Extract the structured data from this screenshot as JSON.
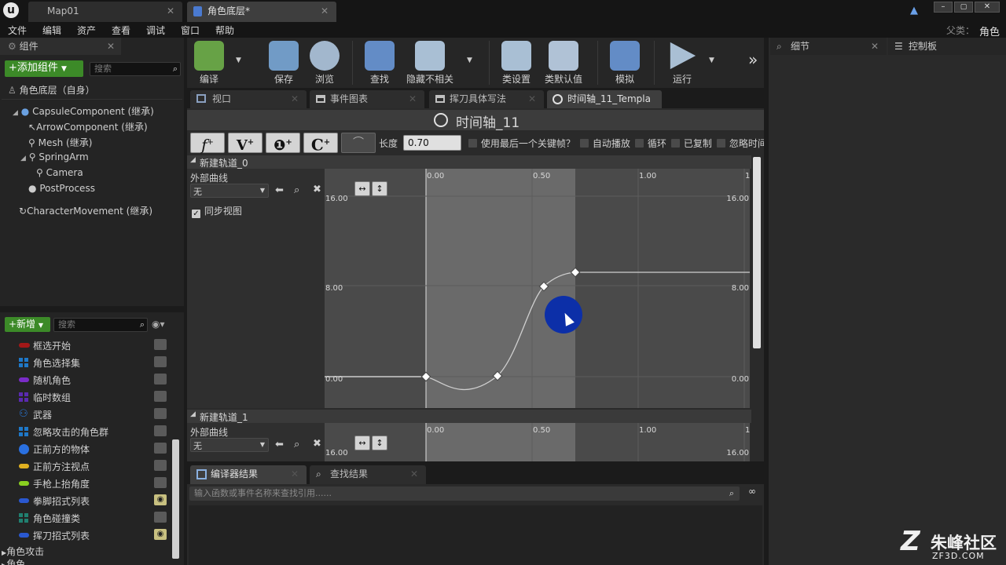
{
  "titlebar": {
    "tabs": [
      {
        "label": "Map01"
      },
      {
        "label": "角色底层*"
      }
    ],
    "parent_label": "父类：",
    "parent_value": "角色"
  },
  "menu": [
    "文件",
    "编辑",
    "资产",
    "查看",
    "调试",
    "窗口",
    "帮助"
  ],
  "components_panel": {
    "title": "组件",
    "add_button": "+添加组件",
    "search_placeholder": "搜索",
    "root": "角色底层（自身）",
    "tree": [
      {
        "label": "CapsuleComponent (继承)"
      },
      {
        "label": "ArrowComponent (继承)"
      },
      {
        "label": "Mesh (继承)"
      },
      {
        "label": "SpringArm"
      },
      {
        "label": "Camera"
      },
      {
        "label": "PostProcess"
      },
      {
        "label": "CharacterMovement (继承)"
      }
    ]
  },
  "mybp_panel": {
    "add_button": "+新增",
    "search_placeholder": "搜索",
    "variables": [
      {
        "label": "框选开始",
        "color": "#a31818",
        "eye": false
      },
      {
        "label": "角色选择集",
        "color": "#1e78c8",
        "eye": false
      },
      {
        "label": "随机角色",
        "color": "#7a2cc8",
        "eye": false
      },
      {
        "label": "临时数组",
        "color": "#5a2ab0",
        "eye": false
      },
      {
        "label": "武器",
        "color": "#2a78d8",
        "eye": false
      },
      {
        "label": "忽略攻击的角色群",
        "color": "#1e78c8",
        "eye": false
      },
      {
        "label": "正前方的物体",
        "color": "#2a70e0",
        "eye": false
      },
      {
        "label": "正前方注视点",
        "color": "#e0b020",
        "eye": false
      },
      {
        "label": "手枪上抬角度",
        "color": "#8ad020",
        "eye": false
      },
      {
        "label": "拳脚招式列表",
        "color": "#2a58d0",
        "eye": true
      },
      {
        "label": "角色碰撞类",
        "color": "#208070",
        "eye": false
      },
      {
        "label": "挥刀招式列表",
        "color": "#2a58d0",
        "eye": true
      }
    ],
    "categories": [
      "角色攻击",
      "角色"
    ]
  },
  "toolbar": {
    "buttons": [
      {
        "label": "编译",
        "icon": "compile-icon"
      },
      {
        "label": "保存",
        "icon": "save-icon"
      },
      {
        "label": "浏览",
        "icon": "browse-icon"
      },
      {
        "label": "查找",
        "icon": "find-icon"
      },
      {
        "label": "隐藏不相关",
        "icon": "hide-unrelated-icon"
      },
      {
        "label": "类设置",
        "icon": "class-settings-icon"
      },
      {
        "label": "类默认值",
        "icon": "class-defaults-icon"
      },
      {
        "label": "模拟",
        "icon": "simulate-icon"
      },
      {
        "label": "运行",
        "icon": "play-icon"
      }
    ]
  },
  "doc_tabs": [
    {
      "label": "视口"
    },
    {
      "label": "事件图表"
    },
    {
      "label": "挥刀具体写法"
    },
    {
      "label": "时间轴_11_Templa"
    }
  ],
  "timeline": {
    "title": "时间轴_11",
    "length_label": "长度",
    "length_value": "0.70",
    "options": [
      {
        "label": "使用最后一个关键帧？"
      },
      {
        "label": "自动播放"
      },
      {
        "label": "循环"
      },
      {
        "label": "已复制"
      },
      {
        "label": "忽略时间"
      }
    ],
    "track0": {
      "name": "新建轨道_0",
      "external_curve_label": "外部曲线",
      "curve_value": "无",
      "sync_view": "同步视图"
    },
    "track1": {
      "name": "新建轨道_1",
      "external_curve_label": "外部曲线",
      "curve_value": "无"
    },
    "x_ticks": [
      "0.00",
      "0.50",
      "1.00",
      "1"
    ],
    "y_ticks": [
      "16.00",
      "8.00",
      "0.00"
    ],
    "track1_y_top": "16.00"
  },
  "results": {
    "tabs": [
      {
        "label": "编译器结果"
      },
      {
        "label": "查找结果"
      }
    ],
    "search_placeholder": "输入函数或事件名称来查找引用......"
  },
  "details_panel": {
    "tabs": [
      {
        "label": "细节"
      },
      {
        "label": "控制板"
      }
    ]
  },
  "watermark": {
    "text": "朱峰社区",
    "url": "ZF3D.COM"
  }
}
